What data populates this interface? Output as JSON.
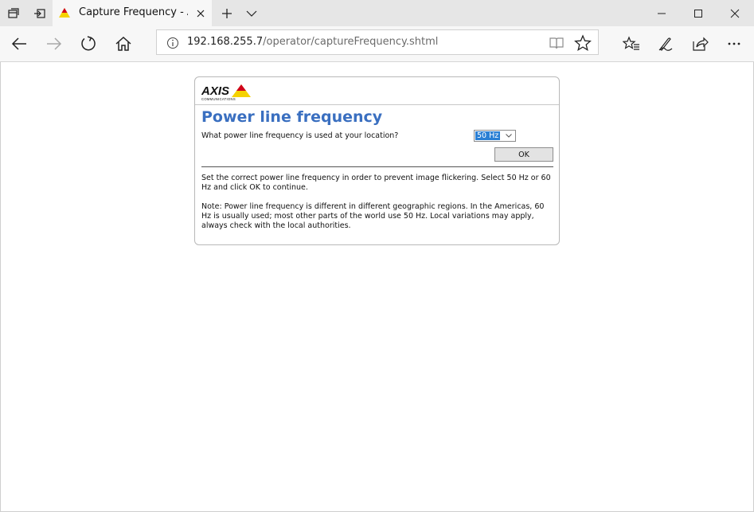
{
  "browser": {
    "tab_title": "Capture Frequency - AX",
    "address_host": "192.168.255.7",
    "address_path": "/operator/captureFrequency.shtml"
  },
  "page": {
    "logo_text": "AXIS",
    "logo_subtext": "COMMUNICATIONS",
    "title": "Power line frequency",
    "question": "What power line frequency is used at your location?",
    "selected_frequency": "50 Hz",
    "ok_label": "OK",
    "instruction": "Set the correct power line frequency in order to prevent image flickering. Select 50 Hz or 60 Hz and click OK to continue.",
    "note": "Note: Power line frequency is different in different geographic regions. In the Americas, 60 Hz is usually used; most other parts of the world use 50 Hz. Local variations may apply, always check with the local authorities."
  },
  "colors": {
    "title_blue": "#3a6fc0",
    "select_highlight": "#2a7fd4",
    "axis_yellow": "#f5d200",
    "axis_red": "#d0021b"
  },
  "icons": {
    "tab_actions": [
      "tabs-aside-icon",
      "tab-back-icon"
    ],
    "nav": [
      "back-arrow-icon",
      "forward-arrow-icon",
      "refresh-icon",
      "home-icon"
    ],
    "right_tools": [
      "favorites-icon",
      "pen-icon",
      "share-icon",
      "more-icon"
    ]
  }
}
